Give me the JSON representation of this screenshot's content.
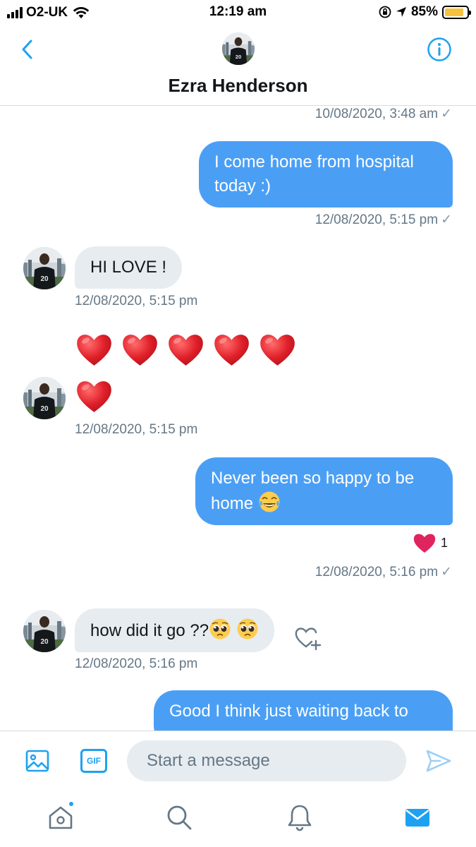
{
  "status_bar": {
    "carrier": "O2-UK",
    "time": "12:19 am",
    "battery_percent": "85%",
    "battery_level": 0.85
  },
  "header": {
    "contact_name": "Ezra Henderson",
    "back_icon": "chevron-left-icon",
    "info_icon": "info-icon"
  },
  "messages": [
    {
      "direction": "meta",
      "timestamp": "10/08/2020, 3:48 am",
      "read_tick": "✓"
    },
    {
      "direction": "outgoing",
      "line1": "I come home from hospital",
      "line2": "today :)",
      "timestamp": "12/08/2020, 5:15 pm",
      "read_tick": "✓"
    },
    {
      "direction": "incoming",
      "text": "HI LOVE !",
      "timestamp": "12/08/2020, 5:15 pm"
    },
    {
      "direction": "incoming",
      "emoji": "red-heart",
      "emoji_count": 6,
      "timestamp": "12/08/2020, 5:15 pm"
    },
    {
      "direction": "outgoing",
      "line1": "Never been so happy to be",
      "line2": "home",
      "emoji": "laughing-tears",
      "reaction": {
        "icon": "heart-icon",
        "count": "1"
      },
      "timestamp": "12/08/2020, 5:16 pm",
      "read_tick": "✓"
    },
    {
      "direction": "incoming",
      "text": "how did it go ??",
      "emoji": "pleading-face",
      "emoji_count": 2,
      "timestamp": "12/08/2020, 5:16 pm"
    },
    {
      "direction": "outgoing",
      "line1": "Good I think just waiting back to"
    }
  ],
  "composer": {
    "placeholder": "Start a message",
    "gif_label": "GIF"
  },
  "tabs": [
    {
      "icon": "home-icon",
      "has_notification_dot": true
    },
    {
      "icon": "search-icon"
    },
    {
      "icon": "bell-icon"
    },
    {
      "icon": "mail-icon",
      "active": true
    }
  ],
  "colors": {
    "accent": "#1da1f2",
    "outgoing_bubble": "#4a9ff5",
    "incoming_bubble": "#e6ecf0",
    "heart": "#e0245e",
    "secondary_text": "#657786"
  }
}
